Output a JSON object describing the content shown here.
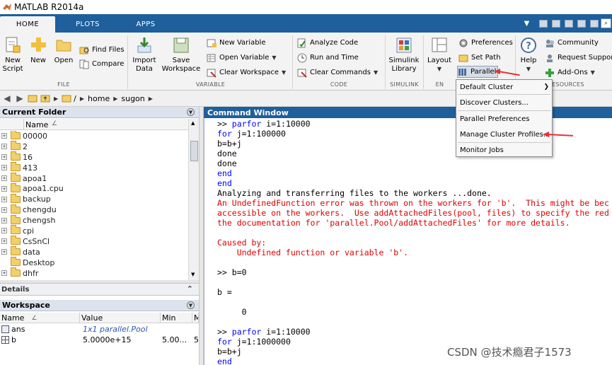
{
  "window": {
    "title": "MATLAB R2014a"
  },
  "tabs": [
    {
      "label": "HOME"
    },
    {
      "label": "PLOTS"
    },
    {
      "label": "APPS"
    }
  ],
  "ribbon": {
    "file": {
      "label": "FILE",
      "new_script": "New Script",
      "new": "New",
      "open": "Open",
      "find_files": "Find Files",
      "compare": "Compare"
    },
    "variable": {
      "label": "VARIABLE",
      "import_data": "Import Data",
      "save_workspace": "Save Workspace",
      "new_variable": "New Variable",
      "open_variable": "Open Variable",
      "clear_workspace": "Clear Workspace"
    },
    "code": {
      "label": "CODE",
      "analyze_code": "Analyze Code",
      "run_and_time": "Run and Time",
      "clear_commands": "Clear Commands"
    },
    "simulink": {
      "label": "SIMULINK",
      "library": "Simulink Library"
    },
    "environment": {
      "label": "EN",
      "layout": "Layout",
      "preferences": "Preferences",
      "set_path": "Set Path",
      "parallel": "Parallel"
    },
    "resources": {
      "label": "RESOURCES",
      "help": "Help",
      "community": "Community",
      "request_support": "Request Support",
      "add_ons": "Add-Ons"
    }
  },
  "path": [
    "/",
    "home",
    "sugon"
  ],
  "current_folder": {
    "title": "Current Folder",
    "column": "Name",
    "sort_mark": "∠",
    "items": [
      {
        "name": "00000",
        "expandable": true
      },
      {
        "name": "2",
        "expandable": true
      },
      {
        "name": "16",
        "expandable": true
      },
      {
        "name": "413",
        "expandable": true
      },
      {
        "name": "apoa1",
        "expandable": true
      },
      {
        "name": "apoa1.cpu",
        "expandable": true
      },
      {
        "name": "backup",
        "expandable": true
      },
      {
        "name": "chengdu",
        "expandable": true
      },
      {
        "name": "chengsh",
        "expandable": true
      },
      {
        "name": "cpi",
        "expandable": true
      },
      {
        "name": "CsSnCl",
        "expandable": true
      },
      {
        "name": "data",
        "expandable": true
      },
      {
        "name": "Desktop",
        "expandable": false
      },
      {
        "name": "dhfr",
        "expandable": true
      }
    ]
  },
  "details": {
    "title": "Details"
  },
  "workspace": {
    "title": "Workspace",
    "columns": [
      "Name",
      "Value",
      "Min",
      "M"
    ],
    "sort_mark": "∠",
    "rows": [
      {
        "name": "ans",
        "value": "1x1 parallel.Pool",
        "min": "",
        "max": ""
      },
      {
        "name": "b",
        "value": "5.0000e+15",
        "min": "5.00...",
        "max": "5"
      }
    ]
  },
  "command_window": {
    "title": "Command Window",
    "lines": [
      {
        "segments": [
          {
            "text": ">> ",
            "style": "plain"
          },
          {
            "text": "parfor",
            "style": "kw"
          },
          {
            "text": " i=1:10000",
            "style": "plain"
          }
        ]
      },
      {
        "segments": [
          {
            "text": "for",
            "style": "kw"
          },
          {
            "text": " j=1:100000",
            "style": "plain"
          }
        ]
      },
      {
        "segments": [
          {
            "text": "b=b+j",
            "style": "plain"
          }
        ]
      },
      {
        "segments": [
          {
            "text": "done",
            "style": "plain"
          }
        ]
      },
      {
        "segments": [
          {
            "text": "done",
            "style": "plain"
          }
        ]
      },
      {
        "segments": [
          {
            "text": "end",
            "style": "kw"
          }
        ]
      },
      {
        "segments": [
          {
            "text": "end",
            "style": "kw"
          }
        ]
      },
      {
        "segments": [
          {
            "text": "Analyzing and transferring files to the workers ...done.",
            "style": "plain"
          }
        ]
      },
      {
        "segments": [
          {
            "text": "An UndefinedFunction error was thrown on the workers for 'b'.  This might be bec",
            "style": "err"
          }
        ]
      },
      {
        "segments": [
          {
            "text": "accessible on the workers.  Use addAttachedFiles(pool, files) to specify the red",
            "style": "err"
          }
        ]
      },
      {
        "segments": [
          {
            "text": "the documentation for 'parallel.Pool/addAttachedFiles' for more details.",
            "style": "err"
          }
        ]
      },
      {
        "segments": [
          {
            "text": "",
            "style": "plain"
          }
        ]
      },
      {
        "segments": [
          {
            "text": "Caused by:",
            "style": "err"
          }
        ]
      },
      {
        "segments": [
          {
            "text": "    Undefined function or variable 'b'.",
            "style": "err"
          }
        ]
      },
      {
        "segments": [
          {
            "text": "",
            "style": "plain"
          }
        ]
      },
      {
        "segments": [
          {
            "text": ">> b=0",
            "style": "plain"
          }
        ]
      },
      {
        "segments": [
          {
            "text": "",
            "style": "plain"
          }
        ]
      },
      {
        "segments": [
          {
            "text": "b =",
            "style": "plain"
          }
        ]
      },
      {
        "segments": [
          {
            "text": "",
            "style": "plain"
          }
        ]
      },
      {
        "segments": [
          {
            "text": "     0",
            "style": "plain"
          }
        ]
      },
      {
        "segments": [
          {
            "text": "",
            "style": "plain"
          }
        ]
      },
      {
        "segments": [
          {
            "text": ">> ",
            "style": "plain"
          },
          {
            "text": "parfor",
            "style": "kw"
          },
          {
            "text": " i=1:10000",
            "style": "plain"
          }
        ]
      },
      {
        "segments": [
          {
            "text": "for",
            "style": "kw"
          },
          {
            "text": " j=1:1000000",
            "style": "plain"
          }
        ]
      },
      {
        "segments": [
          {
            "text": "b=b+j",
            "style": "plain"
          }
        ]
      },
      {
        "segments": [
          {
            "text": "end",
            "style": "kw"
          }
        ]
      }
    ]
  },
  "parallel_menu": {
    "items": [
      {
        "label": "Default Cluster",
        "submenu": true
      },
      {
        "label": "Discover Clusters...",
        "submenu": false
      },
      {
        "label": "Parallel Preferences",
        "submenu": false
      },
      {
        "label": "Manage Cluster Profiles...",
        "submenu": false
      },
      {
        "label": "Monitor Jobs",
        "submenu": false
      }
    ]
  },
  "watermark": "CSDN @技术瘾君子1573",
  "colors": {
    "tab_strip": "#1e5f9c",
    "keyword": "#0000ff",
    "error": "#e00000",
    "annotation_arrow": "#e53434"
  }
}
